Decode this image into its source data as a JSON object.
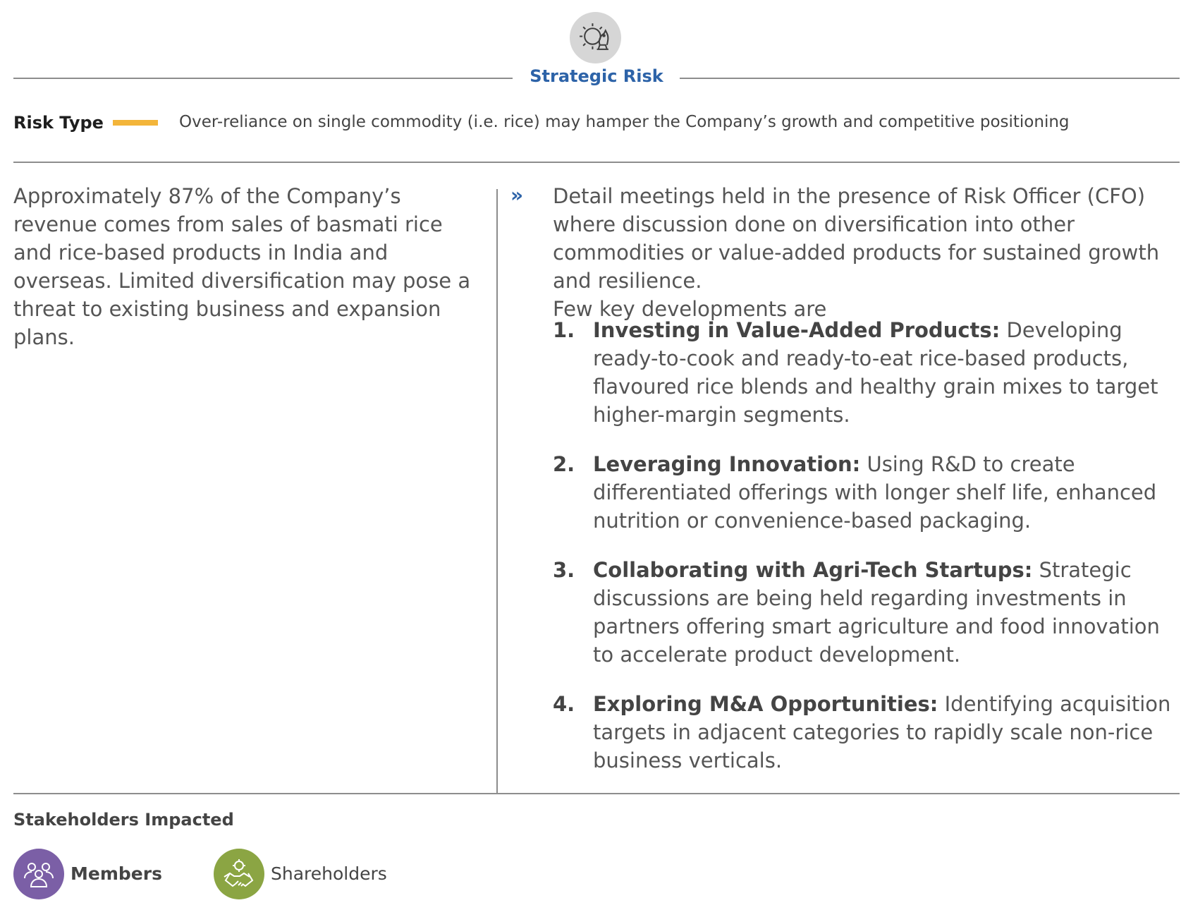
{
  "header": {
    "icon": "chess-knight-gear-icon",
    "title": "Strategic Risk"
  },
  "risk": {
    "label": "Risk Type",
    "accent_color": "#f3b53a",
    "description": "Over-reliance on single commodity (i.e. rice) may hamper the Company’s growth and competitive positioning"
  },
  "left": {
    "text": "Approximately 87% of the Company’s revenue comes from sales of basmati rice and rice-based products in India and overseas. Limited diversification may pose a threat to existing business and expansion plans."
  },
  "right": {
    "bullet": "»",
    "intro": "Detail meetings held in the presence of Risk Officer (CFO) where discussion done on diversification into other commodities or value-added products for sustained growth and resilience.",
    "intro2": "Few key developments are",
    "items": [
      {
        "num": "1.",
        "title": "Investing in Value-Added Products:",
        "text": " Developing ready-to-cook and ready-to-eat rice-based products, flavoured rice blends and healthy grain mixes to target higher-margin segments."
      },
      {
        "num": "2.",
        "title": "Leveraging Innovation:",
        "text": " Using R&D to create differentiated offerings with longer shelf life, enhanced nutrition or convenience-based packaging."
      },
      {
        "num": "3.",
        "title": "Collaborating with Agri-Tech Startups:",
        "text": " Strategic discussions are being held regarding investments in partners offering smart agriculture and food innovation to accelerate product development."
      },
      {
        "num": "4.",
        "title": "Exploring M&A Opportunities:",
        "text": " Identifying acquisition targets in adjacent categories to rapidly scale non-rice business verticals."
      }
    ]
  },
  "stakeholders": {
    "title": "Stakeholders Impacted",
    "items": [
      {
        "label": "Members",
        "color": "#7b5fa6",
        "icon": "members-icon"
      },
      {
        "label": "Shareholders",
        "color": "#8ba543",
        "icon": "handshake-gear-icon"
      }
    ]
  }
}
